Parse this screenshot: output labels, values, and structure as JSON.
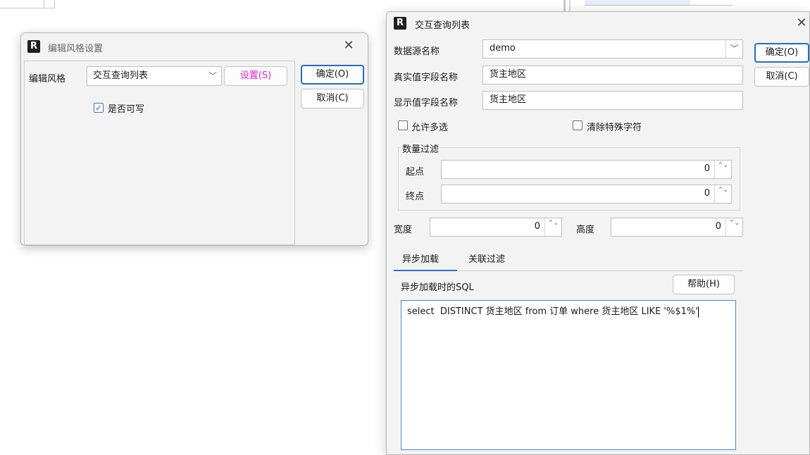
{
  "edit_style_dialog": {
    "title": "编辑风格设置",
    "close_glyph": "✕",
    "style_label": "编辑风格",
    "style_value": "交互查询列表",
    "settings_button": "设置(S)",
    "writable_label": "是否可写",
    "ok_button": "确定(O)",
    "cancel_button": "取消(C)",
    "settings_color": "#e020d0"
  },
  "query_list_dialog": {
    "title": "交互查询列表",
    "close_glyph": "✕",
    "datasource_label": "数据源名称",
    "datasource_value": "demo",
    "real_field_label": "真实值字段名称",
    "real_field_value": "货主地区",
    "display_field_label": "显示值字段名称",
    "display_field_value": "货主地区",
    "allow_multi_label": "允许多选",
    "clear_special_label": "清除特殊字符",
    "quantity_filter_label": "数量过滤",
    "start_label": "起点",
    "start_value": "0",
    "end_label": "终点",
    "end_value": "0",
    "width_label": "宽度",
    "width_value": "0",
    "height_label": "高度",
    "height_value": "0",
    "tabs": [
      "异步加载",
      "关联过滤"
    ],
    "sql_label": "异步加载时的SQL",
    "help_button": "帮助(H)",
    "sql_text": "select  DISTINCT 货主地区 from 订单 where 货主地区 LIKE '%$1%'",
    "ok_button": "确定(O)",
    "cancel_button": "取消(C)"
  },
  "icons": {
    "app_icon": "R",
    "chevron_down": "﹀",
    "spin_arrows": "⌃⌄",
    "checkmark": "✓"
  },
  "colors": {
    "accent": "#1f6fbf",
    "tab_accent": "#2f75c7"
  }
}
